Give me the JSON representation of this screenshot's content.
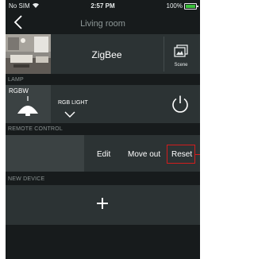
{
  "status_bar": {
    "carrier": "No SIM",
    "time": "2:57 PM",
    "battery": "100%"
  },
  "nav": {
    "title": "Living room"
  },
  "hub": {
    "name": "ZigBee",
    "scene_label": "Scene"
  },
  "sections": {
    "lamp": "LAMP",
    "remote": "REMOTE CONTROL",
    "new_device": "NEW DEVICE"
  },
  "lamp": {
    "type_label": "RGBW",
    "name": "RGB LIGHT"
  },
  "remote": {
    "actions": {
      "edit": "Edit",
      "move_out": "Move out",
      "reset": "Reset"
    }
  },
  "icons": {
    "back": "chevron-left-icon",
    "scene": "scene-icon",
    "lamp": "pendant-lamp-icon",
    "expand": "chevron-down-icon",
    "power": "power-icon",
    "add": "plus-icon"
  },
  "colors": {
    "background": "#171b1c",
    "row": "#2c3334",
    "tile": "#3b4243",
    "section_text": "#8a9292",
    "highlight": "#d21d1d",
    "battery": "#3cc23c"
  }
}
